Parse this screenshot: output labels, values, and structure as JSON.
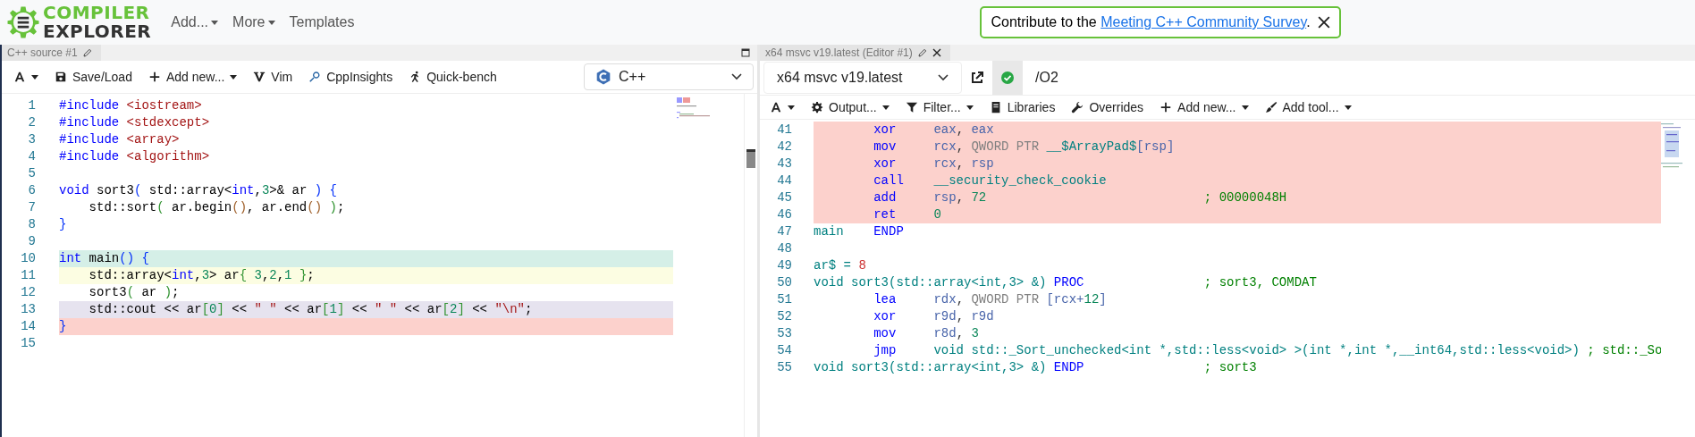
{
  "header": {
    "logo_top": "COMPILER",
    "logo_bottom": "EXPLORER",
    "menu": [
      {
        "label": "Add...",
        "dropdown": true
      },
      {
        "label": "More",
        "dropdown": true
      },
      {
        "label": "Templates",
        "dropdown": false
      }
    ],
    "banner": {
      "text": "Contribute to the ",
      "link": "Meeting C++ Community Survey",
      "suffix": "."
    }
  },
  "source_pane": {
    "tab": "C++ source #1",
    "language": "C++",
    "toolbar": [
      {
        "kind": "font",
        "dropdown": true
      },
      {
        "kind": "save",
        "label": "Save/Load",
        "dropdown": false
      },
      {
        "kind": "plus",
        "label": "Add new...",
        "dropdown": true
      },
      {
        "kind": "vim",
        "label": "Vim",
        "dropdown": false
      },
      {
        "kind": "insights",
        "label": "CppInsights",
        "dropdown": false
      },
      {
        "kind": "bench",
        "label": "Quick-bench",
        "dropdown": false
      }
    ],
    "lines": [
      {
        "number": "1",
        "tokens": [
          {
            "text": "#include",
            "kind": "kw"
          },
          {
            "text": " <iostream>",
            "kind": "str"
          }
        ]
      },
      {
        "number": "2",
        "tokens": [
          {
            "text": "#include",
            "kind": "kw"
          },
          {
            "text": " <stdexcept>",
            "kind": "str"
          }
        ]
      },
      {
        "number": "3",
        "tokens": [
          {
            "text": "#include",
            "kind": "kw"
          },
          {
            "text": " <array>",
            "kind": "str"
          }
        ]
      },
      {
        "number": "4",
        "tokens": [
          {
            "text": "#include",
            "kind": "kw"
          },
          {
            "text": " <algorithm>",
            "kind": "str"
          }
        ]
      },
      {
        "number": "5"
      },
      {
        "number": "6",
        "tokens": [
          {
            "text": "void",
            "kind": "kw"
          },
          {
            "text": " sort3",
            "kind": "plain"
          },
          {
            "text": "(",
            "kind": "br1"
          },
          {
            "text": " std::array<",
            "kind": "plain"
          },
          {
            "text": "int",
            "kind": "kw"
          },
          {
            "text": ",",
            "kind": "plain"
          },
          {
            "text": "3",
            "kind": "num"
          },
          {
            "text": ">& ar ",
            "kind": "plain"
          },
          {
            "text": ")",
            "kind": "br1"
          },
          {
            "text": " {",
            "kind": "br1"
          }
        ]
      },
      {
        "number": "7",
        "tokens": [
          {
            "text": "    std::sort",
            "kind": "plain"
          },
          {
            "text": "(",
            "kind": "br2"
          },
          {
            "text": " ar.begin",
            "kind": "plain"
          },
          {
            "text": "()",
            "kind": "br3"
          },
          {
            "text": ", ar.end",
            "kind": "plain"
          },
          {
            "text": "()",
            "kind": "br3"
          },
          {
            "text": " )",
            "kind": "br2"
          },
          {
            "text": ";",
            "kind": "plain"
          }
        ]
      },
      {
        "number": "8",
        "tokens": [
          {
            "text": "}",
            "kind": "br1"
          }
        ]
      },
      {
        "number": "9"
      },
      {
        "number": "10",
        "color": "#d5efe7",
        "tokens": [
          {
            "text": "int",
            "kind": "kw"
          },
          {
            "text": " main",
            "kind": "plain"
          },
          {
            "text": "()",
            "kind": "br1"
          },
          {
            "text": " {",
            "kind": "br1"
          }
        ]
      },
      {
        "number": "11",
        "color": "#fcfde2",
        "tokens": [
          {
            "text": "    std::array<",
            "kind": "plain"
          },
          {
            "text": "int",
            "kind": "kw"
          },
          {
            "text": ",",
            "kind": "plain"
          },
          {
            "text": "3",
            "kind": "num"
          },
          {
            "text": "> ar",
            "kind": "plain"
          },
          {
            "text": "{",
            "kind": "br2"
          },
          {
            "text": " 3",
            "kind": "num"
          },
          {
            "text": ",",
            "kind": "plain"
          },
          {
            "text": "2",
            "kind": "num"
          },
          {
            "text": ",",
            "kind": "plain"
          },
          {
            "text": "1",
            "kind": "num"
          },
          {
            "text": " }",
            "kind": "br2"
          },
          {
            "text": ";",
            "kind": "plain"
          }
        ]
      },
      {
        "number": "12",
        "tokens": [
          {
            "text": "    sort3",
            "kind": "plain"
          },
          {
            "text": "(",
            "kind": "br2"
          },
          {
            "text": " ar ",
            "kind": "plain"
          },
          {
            "text": ")",
            "kind": "br2"
          },
          {
            "text": ";",
            "kind": "plain"
          }
        ]
      },
      {
        "number": "13",
        "color": "#e6e3ef",
        "tokens": [
          {
            "text": "    std::cout << ar",
            "kind": "plain"
          },
          {
            "text": "[",
            "kind": "br2"
          },
          {
            "text": "0",
            "kind": "num"
          },
          {
            "text": "]",
            "kind": "br2"
          },
          {
            "text": " << ",
            "kind": "plain"
          },
          {
            "text": "\" \"",
            "kind": "str"
          },
          {
            "text": " << ar",
            "kind": "plain"
          },
          {
            "text": "[",
            "kind": "br2"
          },
          {
            "text": "1",
            "kind": "num"
          },
          {
            "text": "]",
            "kind": "br2"
          },
          {
            "text": " << ",
            "kind": "plain"
          },
          {
            "text": "\" \"",
            "kind": "str"
          },
          {
            "text": " << ar",
            "kind": "plain"
          },
          {
            "text": "[",
            "kind": "br2"
          },
          {
            "text": "2",
            "kind": "num"
          },
          {
            "text": "]",
            "kind": "br2"
          },
          {
            "text": " << ",
            "kind": "plain"
          },
          {
            "text": "\"\\n\"",
            "kind": "str"
          },
          {
            "text": ";",
            "kind": "plain"
          }
        ]
      },
      {
        "number": "14",
        "color": "#fcd1cc",
        "tokens": [
          {
            "text": "}",
            "kind": "br1"
          }
        ]
      },
      {
        "number": "15"
      }
    ]
  },
  "compiler_pane": {
    "tab": "x64 msvc v19.latest (Editor #1)",
    "compiler": "x64 msvc v19.latest",
    "options": "/O2",
    "toolbar": [
      {
        "kind": "font",
        "dropdown": true
      },
      {
        "kind": "gear",
        "label": "Output...",
        "dropdown": true
      },
      {
        "kind": "filter",
        "label": "Filter...",
        "dropdown": true
      },
      {
        "kind": "book",
        "label": "Libraries",
        "dropdown": false
      },
      {
        "kind": "wrench",
        "label": "Overrides",
        "dropdown": false
      },
      {
        "kind": "plus",
        "label": "Add new...",
        "dropdown": true
      },
      {
        "kind": "brush",
        "label": "Add tool...",
        "dropdown": true
      }
    ],
    "lines": [
      {
        "number": "41",
        "color": "#fcd1cc",
        "opcode": "xor",
        "operands": [
          {
            "text": "eax",
            "kind": "reg"
          },
          {
            "text": ", ",
            "kind": "plain"
          },
          {
            "text": "eax",
            "kind": "reg"
          }
        ]
      },
      {
        "number": "42",
        "color": "#fcd1cc",
        "opcode": "mov",
        "operands": [
          {
            "text": "rcx",
            "kind": "reg"
          },
          {
            "text": ", ",
            "kind": "plain"
          },
          {
            "text": "QWORD PTR",
            "kind": "ptr"
          },
          {
            "text": " __$ArrayPad$",
            "kind": "sym"
          },
          {
            "text": "[rsp]",
            "kind": "reg"
          }
        ]
      },
      {
        "number": "43",
        "color": "#fcd1cc",
        "opcode": "xor",
        "operands": [
          {
            "text": "rcx",
            "kind": "reg"
          },
          {
            "text": ", ",
            "kind": "plain"
          },
          {
            "text": "rsp",
            "kind": "reg"
          }
        ]
      },
      {
        "number": "44",
        "color": "#fcd1cc",
        "opcode": "call",
        "operands": [
          {
            "text": "__security_check_cookie",
            "kind": "sym"
          }
        ]
      },
      {
        "number": "45",
        "color": "#fcd1cc",
        "opcode": "add",
        "operands": [
          {
            "text": "rsp",
            "kind": "reg"
          },
          {
            "text": ", ",
            "kind": "plain"
          },
          {
            "text": "72",
            "kind": "num"
          }
        ],
        "comment": "; 00000048H"
      },
      {
        "number": "46",
        "color": "#fcd1cc",
        "opcode": "ret",
        "operands": [
          {
            "text": "0",
            "kind": "num"
          }
        ]
      },
      {
        "number": "47",
        "label": "main",
        "opcode": "ENDP"
      },
      {
        "number": "48"
      },
      {
        "number": "49",
        "label": "ar$ =",
        "operands": [
          {
            "text": " 8",
            "kind": "value"
          }
        ]
      },
      {
        "number": "50",
        "label": "void sort3(std::array<int,3> &)",
        "opcode": "PROC",
        "comment": "; sort3, COMDAT"
      },
      {
        "number": "51",
        "opcode": "lea",
        "operands": [
          {
            "text": "rdx",
            "kind": "reg"
          },
          {
            "text": ", ",
            "kind": "plain"
          },
          {
            "text": "QWORD PTR",
            "kind": "ptr"
          },
          {
            "text": " [rcx+",
            "kind": "reg"
          },
          {
            "text": "12",
            "kind": "num"
          },
          {
            "text": "]",
            "kind": "reg"
          }
        ]
      },
      {
        "number": "52",
        "opcode": "xor",
        "operands": [
          {
            "text": "r9d",
            "kind": "reg"
          },
          {
            "text": ", ",
            "kind": "plain"
          },
          {
            "text": "r9d",
            "kind": "reg"
          }
        ]
      },
      {
        "number": "53",
        "opcode": "mov",
        "operands": [
          {
            "text": "r8d",
            "kind": "reg"
          },
          {
            "text": ", ",
            "kind": "plain"
          },
          {
            "text": "3",
            "kind": "num"
          }
        ]
      },
      {
        "number": "54",
        "opcode": "jmp",
        "operands": [
          {
            "text": "void std::_Sort_unchecked<int *,std::less<void> >(int *,int *,__int64,std::less<void>)",
            "kind": "sym"
          }
        ],
        "comment": "; std::_So"
      },
      {
        "number": "55",
        "label": "void sort3(std::array<int,3> &)",
        "opcode": "ENDP",
        "comment": "; sort3"
      }
    ]
  }
}
